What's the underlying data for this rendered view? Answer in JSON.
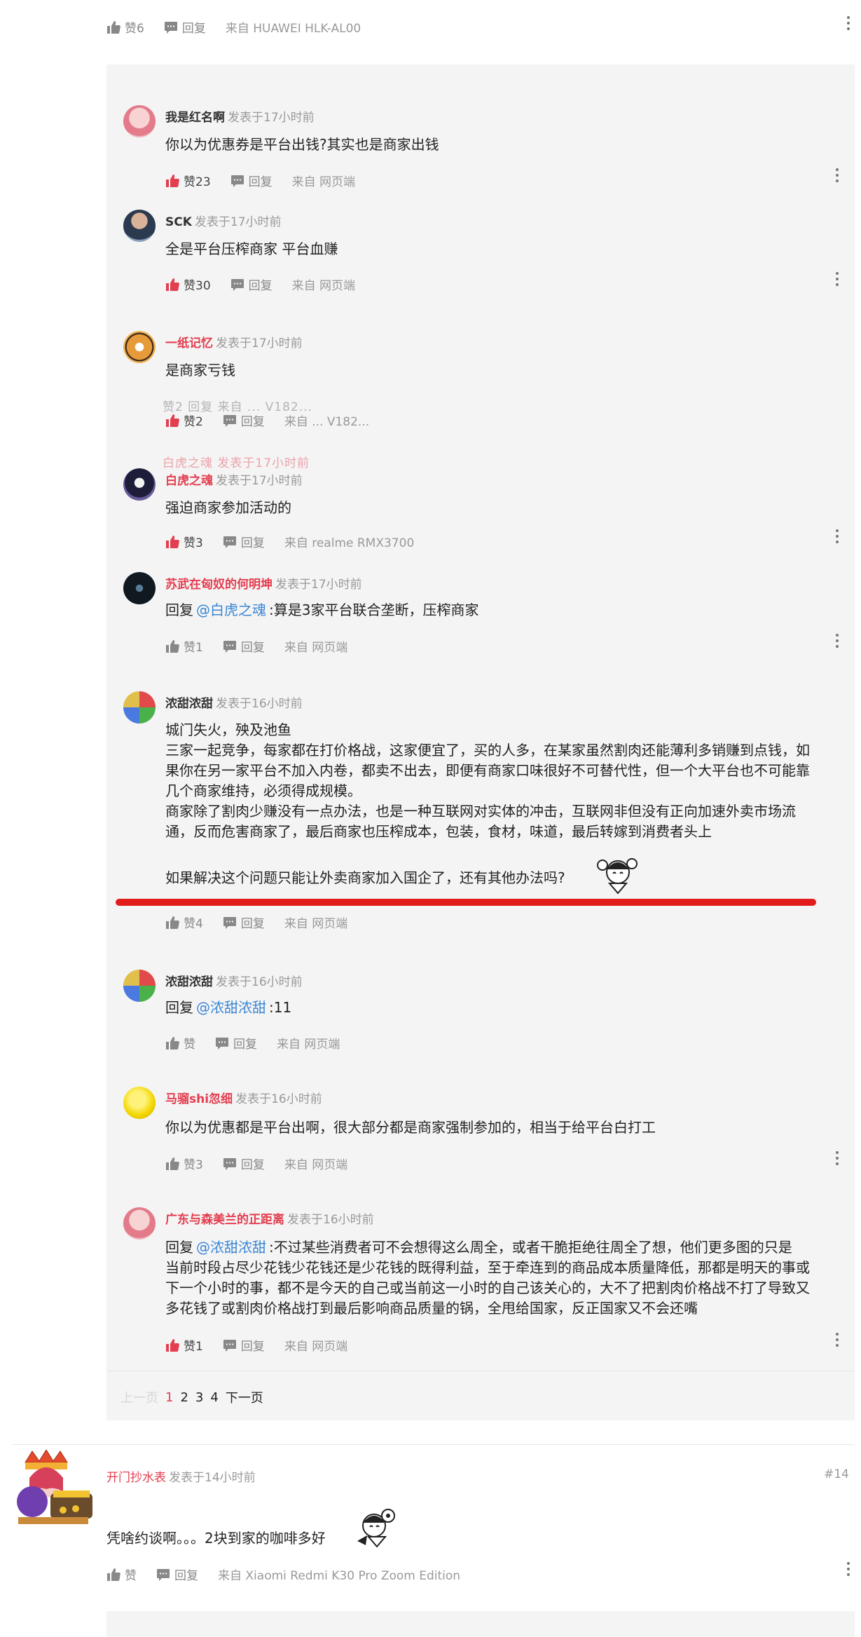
{
  "top_post_actions": {
    "like": "赞6",
    "reply": "回复",
    "from": "来自 HUAWEI  HLK-AL00"
  },
  "replies": [
    {
      "user": "我是红名啊",
      "time": "发表于17小时前",
      "text": "你以为优惠券是平台出钱?其实也是商家出钱",
      "like": "赞23",
      "reply": "回复",
      "from": "来自 网页端"
    },
    {
      "user": "SCK",
      "time": "发表于17小时前",
      "text": "全是平台压榨商家  平台血赚",
      "like": "赞30",
      "reply": "回复",
      "from": "来自 网页端"
    },
    {
      "user": "一纸记忆",
      "time": "发表于17小时前",
      "text": "是商家亏钱",
      "like": "赞2",
      "reply": "回复",
      "from": "来自 ...  V182..."
    },
    {
      "user": "白虎之魂",
      "time": "发表于17小时前",
      "text": "强迫商家参加活动的",
      "like": "赞3",
      "reply": "回复",
      "from": "来自 realme  RMX3700"
    },
    {
      "user": "苏武在匈奴的何明坤",
      "time": "发表于17小时前",
      "reply_prefix": "回复",
      "at": "@白虎之魂",
      "text": ":算是3家平台联合垄断，压榨商家",
      "like": "赞1",
      "reply": "回复",
      "from": "来自 网页端"
    },
    {
      "user": "浓甜浓甜",
      "time": "发表于16小时前",
      "lines": [
        "城门失火，殃及池鱼",
        "三家一起竞争，每家都在打价格战，这家便宜了，买的人多，在某家虽然割肉还能薄利多销赚到点钱，如",
        "果你在另一家平台不加入内卷，都卖不出去，即便有商家口味很好不可替代性，但一个大平台也不可能靠",
        "几个商家维持，必须得成规模。",
        "商家除了割肉少赚没有一点办法，也是一种互联网对实体的冲击，互联网非但没有正向加速外卖市场流",
        "通，反而危害商家了，最后商家也压榨成本，包装，食材，味道，最后转嫁到消费者头上",
        "",
        "如果解决这个问题只能让外卖商家加入国企了，还有其他办法吗?"
      ],
      "like": "赞4",
      "reply": "回复",
      "from": "来自 网页端"
    },
    {
      "user": "浓甜浓甜",
      "time": "发表于16小时前",
      "reply_prefix": "回复",
      "at": "@浓甜浓甜",
      "text": ":11",
      "like": "赞",
      "reply": "回复",
      "from": "来自 网页端"
    },
    {
      "user": "马骝shi忽细",
      "time": "发表于16小时前",
      "text": "你以为优惠都是平台出啊，很大部分都是商家强制参加的，相当于给平台白打工",
      "like": "赞3",
      "reply": "回复",
      "from": "来自 网页端"
    },
    {
      "user": "广东与森美兰的正距离",
      "time": "发表于16小时前",
      "reply_prefix": "回复",
      "at": "@浓甜浓甜",
      "lines": [
        ":不过某些消费者可不会想得这么周全，或者干脆拒绝往周全了想，他们更多图的只是",
        "当前时段占尽少花钱少花钱还是少花钱的既得利益，至于牵连到的商品成本质量降低，那都是明天的事或",
        "下一个小时的事，都不是今天的自己或当前这一小时的自己该关心的，大不了把割肉价格战不打了导致又",
        "多花钱了或割肉价格战打到最后影响商品质量的锅，全甩给国家，反正国家又不会还嘴"
      ],
      "like": "赞1",
      "reply": "回复",
      "from": "来自 网页端"
    }
  ],
  "glitch": {
    "row1": "赞2  回复  来自 ...  V182...",
    "row2": "白虎之魂  发表于17小时前"
  },
  "pagination": {
    "prev": "上一页",
    "pages": [
      "1",
      "2",
      "3",
      "4"
    ],
    "next": "下一页"
  },
  "post14": {
    "user": "开门抄水表",
    "time": "发表于14小时前",
    "floor": "#14",
    "text": "凭啥约谈啊。。。2块到家的咖啡多好",
    "like": "赞",
    "reply": "回复",
    "from": "来自 Xiaomi  Redmi  K30  Pro  Zoom  Edition"
  },
  "colors": {
    "accent_red": "#e33e4f",
    "link_blue": "#3a86d4",
    "panel_bg": "#f4f4f4",
    "underline": "#e31b1b"
  }
}
